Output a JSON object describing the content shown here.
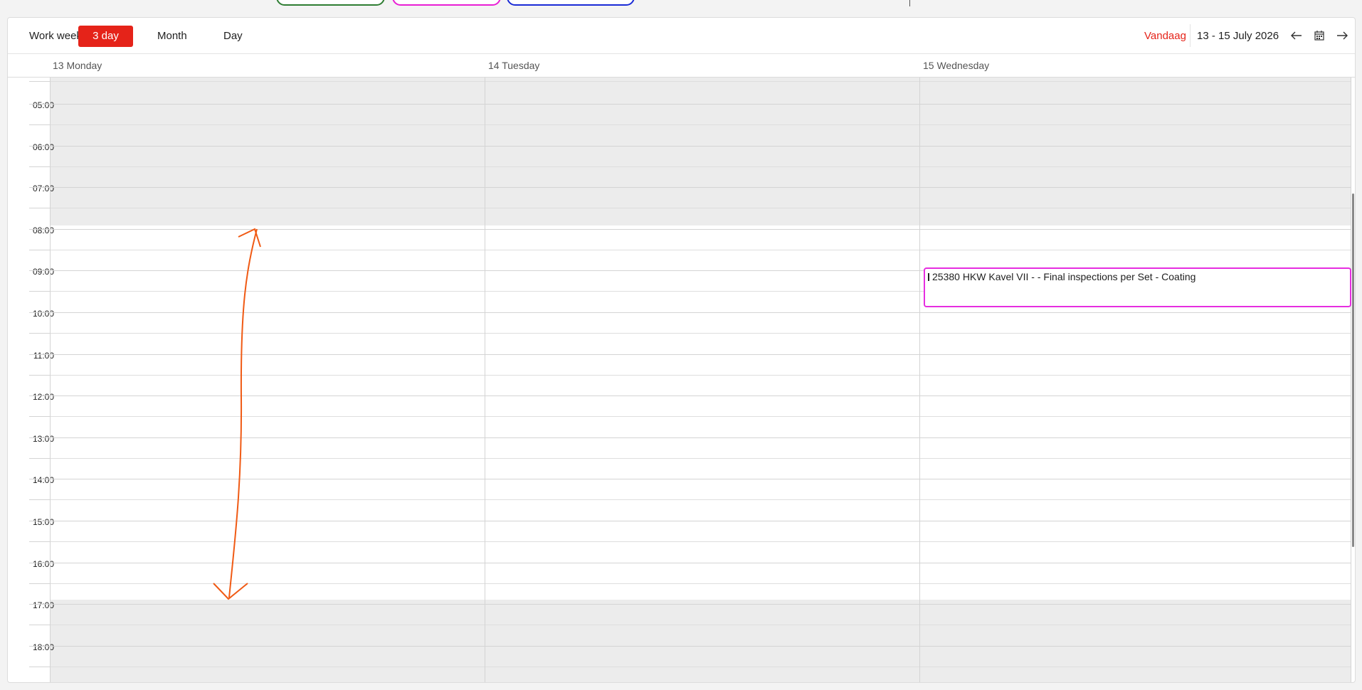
{
  "view_tabs": [
    {
      "label": "Work week",
      "active": false
    },
    {
      "label": "3 day",
      "active": true
    },
    {
      "label": "Month",
      "active": false
    },
    {
      "label": "Day",
      "active": false
    }
  ],
  "toolbar": {
    "today_label": "Vandaag",
    "date_range": "13  - 15 July 2026"
  },
  "days": [
    "13 Monday",
    "14 Tuesday",
    "15 Wednesday"
  ],
  "hours": [
    "05:00",
    "06:00",
    "07:00",
    "08:00",
    "09:00",
    "10:00",
    "11:00",
    "12:00",
    "13:00",
    "14:00",
    "15:00",
    "16:00",
    "17:00",
    "18:00"
  ],
  "event": {
    "title": "25380 HKW Kavel VII -  - Final inspections per Set - Coating",
    "day": "15 Wednesday",
    "start": "10:00",
    "end": "11:00",
    "color": "#e62ee0"
  },
  "colors": {
    "accent": "#e52319",
    "legend_chips": [
      "#2e7d32",
      "#e91ed4",
      "#1a2bd6"
    ],
    "annotation_arrow": "#f05a14",
    "non_working_shade": "#ececec"
  },
  "icons": {
    "prev": "arrow-left-icon",
    "calendar": "calendar-icon",
    "next": "arrow-right-icon"
  }
}
